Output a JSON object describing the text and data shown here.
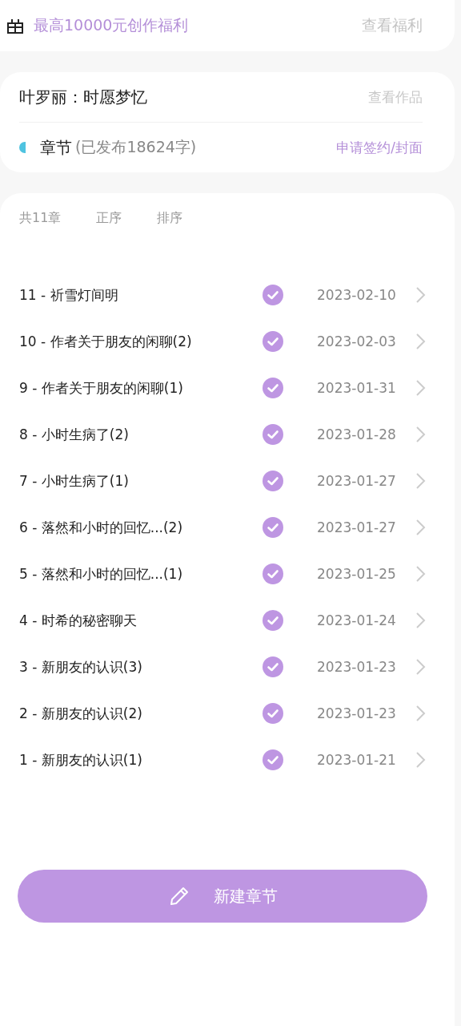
{
  "benefit_bar": {
    "text": "最高10000元创作福利",
    "link": "查看福利"
  },
  "work": {
    "title": "叶罗丽：时愿梦忆",
    "view_link": "查看作品",
    "chapters_label": "章节",
    "published_count": "(已发布18624字)",
    "apply_link": "申请签约/封面"
  },
  "list_header": {
    "total": "共11章",
    "order": "正序",
    "sort": "排序"
  },
  "chapters": [
    {
      "title": "11 - 祈雪灯间明",
      "published": true,
      "date": "2023-02-10"
    },
    {
      "title": "10 - 作者关于朋友的闲聊(2)",
      "published": true,
      "date": "2023-02-03"
    },
    {
      "title": "9 - 作者关于朋友的闲聊(1)",
      "published": true,
      "date": "2023-01-31"
    },
    {
      "title": "8 - 小时生病了(2)",
      "published": true,
      "date": "2023-01-28"
    },
    {
      "title": "7 - 小时生病了(1)",
      "published": true,
      "date": "2023-01-27"
    },
    {
      "title": "6 - 落然和小时的回忆...(2)",
      "published": true,
      "date": "2023-01-27"
    },
    {
      "title": "5 - 落然和小时的回忆...(1)",
      "published": true,
      "date": "2023-01-25"
    },
    {
      "title": "4 - 时希的秘密聊天",
      "published": true,
      "date": "2023-01-24"
    },
    {
      "title": "3 - 新朋友的认识(3)",
      "published": true,
      "date": "2023-01-23"
    },
    {
      "title": "2 - 新朋友的认识(2)",
      "published": true,
      "date": "2023-01-23"
    },
    {
      "title": "1 - 新朋友的认识(1)",
      "published": true,
      "date": "2023-01-21"
    }
  ],
  "new_chapter_button": "新建章节"
}
